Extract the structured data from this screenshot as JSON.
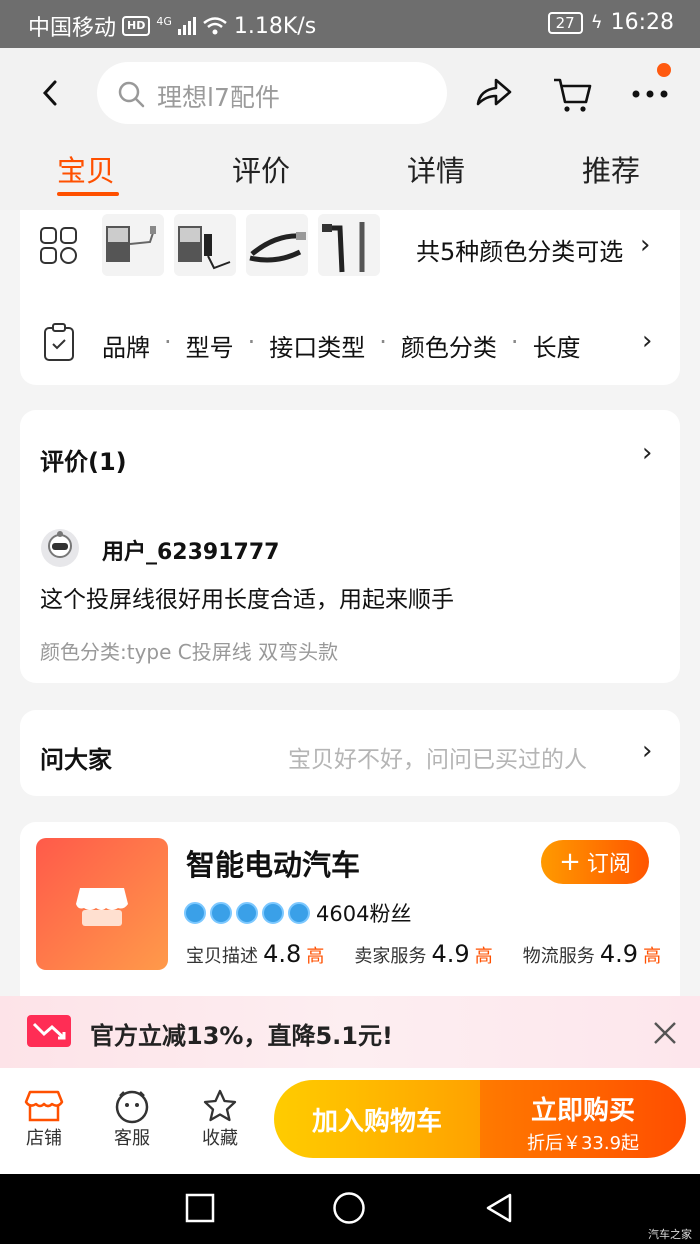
{
  "status": {
    "carrier": "中国移动",
    "hd": "HD",
    "net": "4G",
    "speed": "1.18K/s",
    "battery": "27",
    "time": "16:28"
  },
  "header": {
    "search_placeholder": "理想l7配件"
  },
  "tabs": [
    "宝贝",
    "评价",
    "详情",
    "推荐"
  ],
  "product": {
    "variants_text": "共5种颜色分类可选",
    "params_items": [
      "品牌",
      "型号",
      "接口类型",
      "颜色分类",
      "长度"
    ]
  },
  "reviews": {
    "title": "评价(1)",
    "user": "用户_62391777",
    "content": "这个投屏线很好用长度合适，用起来顺手",
    "variant": "颜色分类:type C投屏线 双弯头款"
  },
  "qa": {
    "title": "问大家",
    "hint": "宝贝好不好，问问已买过的人"
  },
  "store": {
    "name": "智能电动汽车",
    "subscribe": "订阅",
    "fans": "4604粉丝",
    "scores": [
      {
        "label": "宝贝描述",
        "value": "4.8",
        "tag": "高"
      },
      {
        "label": "卖家服务",
        "value": "4.9",
        "tag": "高"
      },
      {
        "label": "物流服务",
        "value": "4.9",
        "tag": "高"
      }
    ]
  },
  "promo": {
    "text": "官方立减13%，直降5.1元!"
  },
  "bottom": {
    "shop": "店铺",
    "service": "客服",
    "favorite": "收藏",
    "add_cart": "加入购物车",
    "buy_now": "立即购买",
    "buy_price": "折后￥33.9起"
  },
  "watermark": "汽车之家",
  "colors": {
    "accent": "#ff5000",
    "cart_button": "#ffb400",
    "buy_button": "#ff5a00"
  }
}
